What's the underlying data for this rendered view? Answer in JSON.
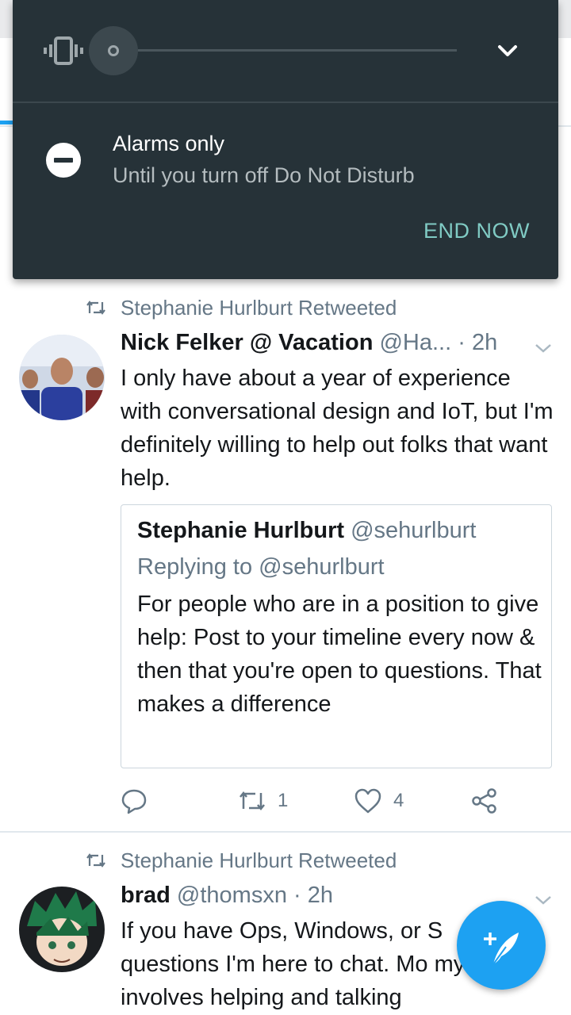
{
  "dnd": {
    "mode_title": "Alarms only",
    "mode_subtitle": "Until you turn off Do Not Disturb",
    "end_now": "END NOW"
  },
  "tweets": [
    {
      "retweeted_by": "Stephanie Hurlburt Retweeted",
      "name": "Nick Felker @ Vacation",
      "handle": "@Ha...",
      "time": "· 2h",
      "text": "I only have about a year of experience with conversational design and IoT, but I'm definitely willing to help out folks that want help.",
      "quote": {
        "name": "Stephanie Hurlburt",
        "handle": "@sehurlburt",
        "replying_to": "Replying to @sehurlburt",
        "text": "For people who are in a position to give help: Post to your timeline every now & then that you're open to questions. That makes a difference"
      },
      "retweets": "1",
      "likes": "4"
    },
    {
      "retweeted_by": "Stephanie Hurlburt Retweeted",
      "name": "brad",
      "handle": "@thomsxn",
      "time": "· 2h",
      "text": "If you have Ops, Windows, or S questions I'm here to chat. Mo my day involves helping and talking"
    }
  ],
  "colors": {
    "accent": "#1da1f2",
    "panel_bg": "#263238",
    "end_now": "#80cbc4",
    "secondary_text": "#657786"
  },
  "icons": {
    "vibrate": "vibrate-icon",
    "expand": "chevron-down-icon",
    "dnd": "do-not-disturb-icon",
    "retweet": "retweet-icon",
    "reply": "reply-icon",
    "like": "heart-icon",
    "share": "share-icon",
    "compose": "compose-tweet-icon"
  }
}
